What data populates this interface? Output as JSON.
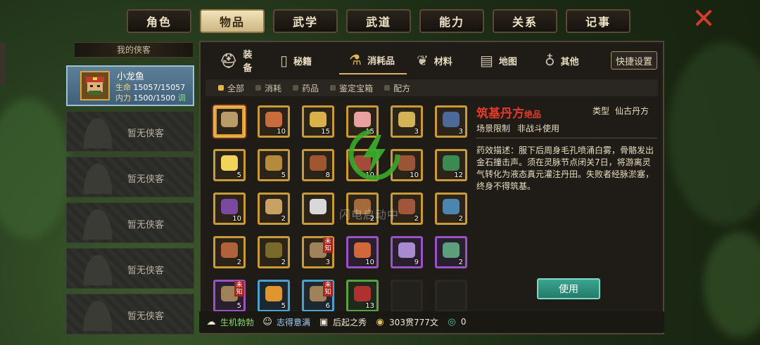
{
  "top_tabs": [
    "角色",
    "物品",
    "武学",
    "武道",
    "能力",
    "关系",
    "记事"
  ],
  "active_top_tab": 1,
  "left": {
    "header": "我的侠客",
    "hero": {
      "name": "小龙鱼",
      "hp_label": "生命",
      "hp_value": "15057/15057",
      "mp_label": "内力",
      "mp_value": "1500/1500",
      "adjust_label": "调"
    },
    "empty_label": "暂无侠客"
  },
  "sub_tabs": [
    {
      "label": "装备",
      "icon": "armor-icon"
    },
    {
      "label": "秘籍",
      "icon": "book-icon"
    },
    {
      "label": "消耗品",
      "icon": "potion-icon"
    },
    {
      "label": "材料",
      "icon": "herb-icon"
    },
    {
      "label": "地图",
      "icon": "map-icon"
    },
    {
      "label": "其他",
      "icon": "misc-icon"
    }
  ],
  "shortcut_label": "快捷设置",
  "filters": [
    "全部",
    "消耗",
    "药品",
    "鉴定宝箱",
    "配方"
  ],
  "active_filter": 0,
  "items": [
    {
      "rarity": "selected",
      "count": "",
      "color": "#b99b6a"
    },
    {
      "rarity": "gold",
      "count": "10",
      "color": "#c96b3a"
    },
    {
      "rarity": "gold",
      "count": "15",
      "color": "#d9b14a"
    },
    {
      "rarity": "gold",
      "count": "15",
      "color": "#e8a0a0"
    },
    {
      "rarity": "gold",
      "count": "3",
      "color": "#d2b456"
    },
    {
      "rarity": "gold",
      "count": "3",
      "color": "#4b6a9a"
    },
    {
      "rarity": "gold",
      "count": "5",
      "color": "#f0d55a"
    },
    {
      "rarity": "gold",
      "count": "5",
      "color": "#b58a3c"
    },
    {
      "rarity": "gold",
      "count": "8",
      "color": "#a0562e"
    },
    {
      "rarity": "gold",
      "count": "10",
      "color": "#a54a3a"
    },
    {
      "rarity": "gold",
      "count": "10",
      "color": "#9a5436"
    },
    {
      "rarity": "gold",
      "count": "12",
      "color": "#3a8a52"
    },
    {
      "rarity": "gold",
      "count": "10",
      "color": "#7b4aa0"
    },
    {
      "rarity": "gold",
      "count": "2",
      "color": "#c8a262"
    },
    {
      "rarity": "gold",
      "count": "",
      "color": "#d8d8d8"
    },
    {
      "rarity": "gold",
      "count": "2",
      "color": "#a56a3a"
    },
    {
      "rarity": "gold",
      "count": "2",
      "color": "#a0563a"
    },
    {
      "rarity": "gold",
      "count": "2",
      "color": "#4a86b0"
    },
    {
      "rarity": "gold",
      "count": "2",
      "color": "#b0623c"
    },
    {
      "rarity": "gold",
      "count": "2",
      "color": "#7a6a2a"
    },
    {
      "rarity": "gold",
      "count": "3",
      "color": "#a0825a",
      "unknown": "未知"
    },
    {
      "rarity": "purple",
      "count": "10",
      "color": "#d2683a"
    },
    {
      "rarity": "purple",
      "count": "9",
      "color": "#a88ad0"
    },
    {
      "rarity": "purple",
      "count": "2",
      "color": "#5aa07a"
    },
    {
      "rarity": "purple",
      "count": "5",
      "color": "#a0825a",
      "unknown": "未知"
    },
    {
      "rarity": "blue",
      "count": "5",
      "color": "#e0952e"
    },
    {
      "rarity": "blue",
      "count": "6",
      "color": "#a0825a",
      "unknown": "未知"
    },
    {
      "rarity": "green",
      "count": "13",
      "color": "#b03030"
    },
    {
      "rarity": "empty",
      "count": "",
      "color": ""
    },
    {
      "rarity": "empty",
      "count": "",
      "color": ""
    }
  ],
  "detail": {
    "name": "筑基丹方",
    "grade": "绝品",
    "type_label": "类型",
    "type_value": "仙古丹方",
    "scene_label": "场景限制",
    "scene_value": "非战斗使用",
    "description": "药效描述：服下后周身毛孔喷涌白雾，骨骼发出金石撞击声。须在灵脉节点闭关7日，将游离灵气转化为液态真元灌注丹田。失败者经脉淤塞，终身不得筑基。",
    "use_label": "使用"
  },
  "loading_text": "闪电启动中",
  "status": {
    "s1": "生机勃勃",
    "s2": "志得意满",
    "s3": "后起之秀",
    "money": "303贯777文",
    "jade": "0"
  }
}
